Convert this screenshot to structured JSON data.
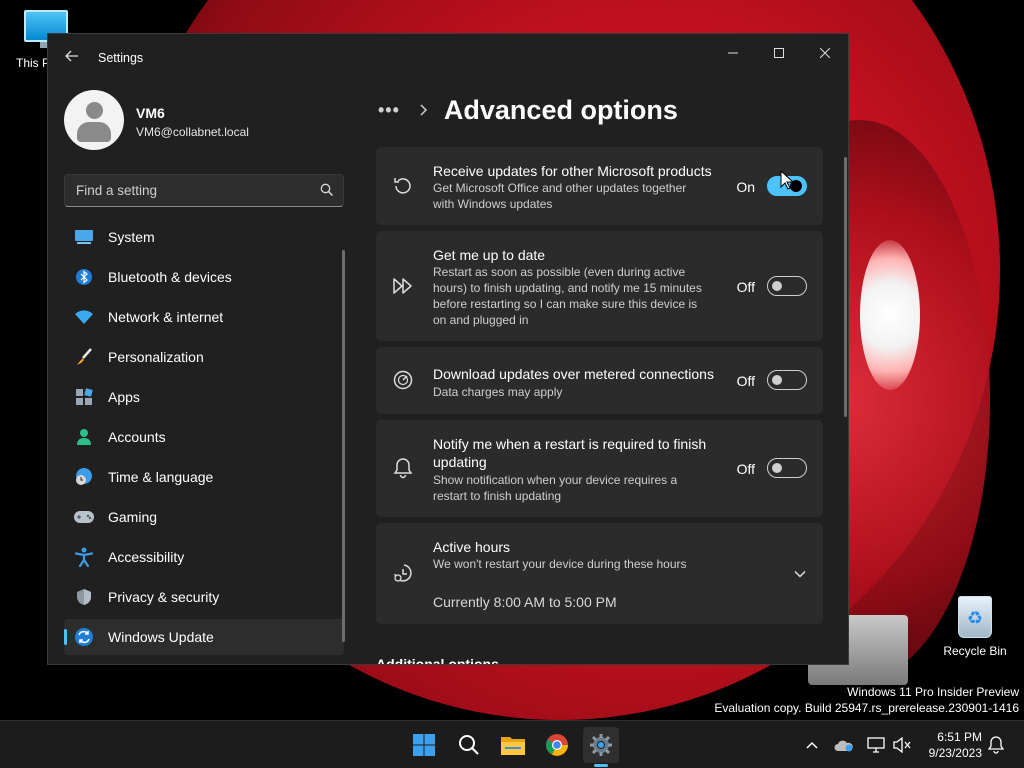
{
  "desktop": {
    "this_pc_label": "This PC",
    "recycle_bin_label": "Recycle Bin",
    "watermark_line1": "Windows 11 Pro Insider Preview",
    "watermark_line2": "Evaluation copy. Build 25947.rs_prerelease.230901-1416"
  },
  "window": {
    "title": "Settings",
    "back_icon": "arrow-left-icon",
    "controls": [
      "minimize-icon",
      "maximize-icon",
      "close-icon"
    ]
  },
  "profile": {
    "name": "VM6",
    "email": "VM6@collabnet.local"
  },
  "search": {
    "placeholder": "Find a setting"
  },
  "nav": {
    "items": [
      {
        "label": "System",
        "icon": "system-icon"
      },
      {
        "label": "Bluetooth & devices",
        "icon": "bluetooth-icon"
      },
      {
        "label": "Network & internet",
        "icon": "wifi-icon"
      },
      {
        "label": "Personalization",
        "icon": "brush-icon"
      },
      {
        "label": "Apps",
        "icon": "apps-icon"
      },
      {
        "label": "Accounts",
        "icon": "person-icon"
      },
      {
        "label": "Time & language",
        "icon": "globe-clock-icon"
      },
      {
        "label": "Gaming",
        "icon": "gamepad-icon"
      },
      {
        "label": "Accessibility",
        "icon": "accessibility-icon"
      },
      {
        "label": "Privacy & security",
        "icon": "shield-icon"
      },
      {
        "label": "Windows Update",
        "icon": "update-icon"
      }
    ],
    "selected": "Windows Update"
  },
  "page": {
    "breadcrumb_more": "•••",
    "title": "Advanced options"
  },
  "settings": {
    "receive_updates": {
      "title": "Receive updates for other Microsoft products",
      "desc_line1": "Get Microsoft Office and other updates together",
      "desc_line2": "with Windows updates",
      "state": "On",
      "enabled": true
    },
    "get_up_to_date": {
      "title": "Get me up to date",
      "desc_line1": "Restart as soon as possible (even during active",
      "desc_line2": "hours) to finish updating, and notify me 15 minutes",
      "desc_line3": "before restarting so I can make sure this device is",
      "desc_line4": "on and plugged in",
      "state": "Off",
      "enabled": false
    },
    "metered": {
      "title": "Download updates over metered connections",
      "desc_line1": "Data charges may apply",
      "state": "Off",
      "enabled": false
    },
    "notify_restart": {
      "title_line1": "Notify me when a restart is required to finish",
      "title_line2": "updating",
      "desc_line1": "Show notification when your device requires a",
      "desc_line2": "restart to finish updating",
      "state": "Off",
      "enabled": false
    },
    "active_hours": {
      "title": "Active hours",
      "desc": "We won't restart your device during these hours",
      "current": "Currently 8:00 AM to 5:00 PM"
    }
  },
  "cut_off_heading": "Additional options",
  "taskbar": {
    "apps": [
      "windows-start-icon",
      "search-icon",
      "file-explorer-icon",
      "chrome-icon",
      "settings-icon"
    ],
    "tray": [
      "chevron-up-icon",
      "onedrive-icon",
      "network-icon",
      "volume-muted-icon"
    ],
    "time": "6:51 PM",
    "date": "9/23/2023",
    "notification_icon": "bell-icon"
  },
  "colors": {
    "accent": "#4cc2ff",
    "window_bg": "#202020",
    "card_bg": "#2b2b2b",
    "taskbar_bg": "#1c1c1c"
  }
}
